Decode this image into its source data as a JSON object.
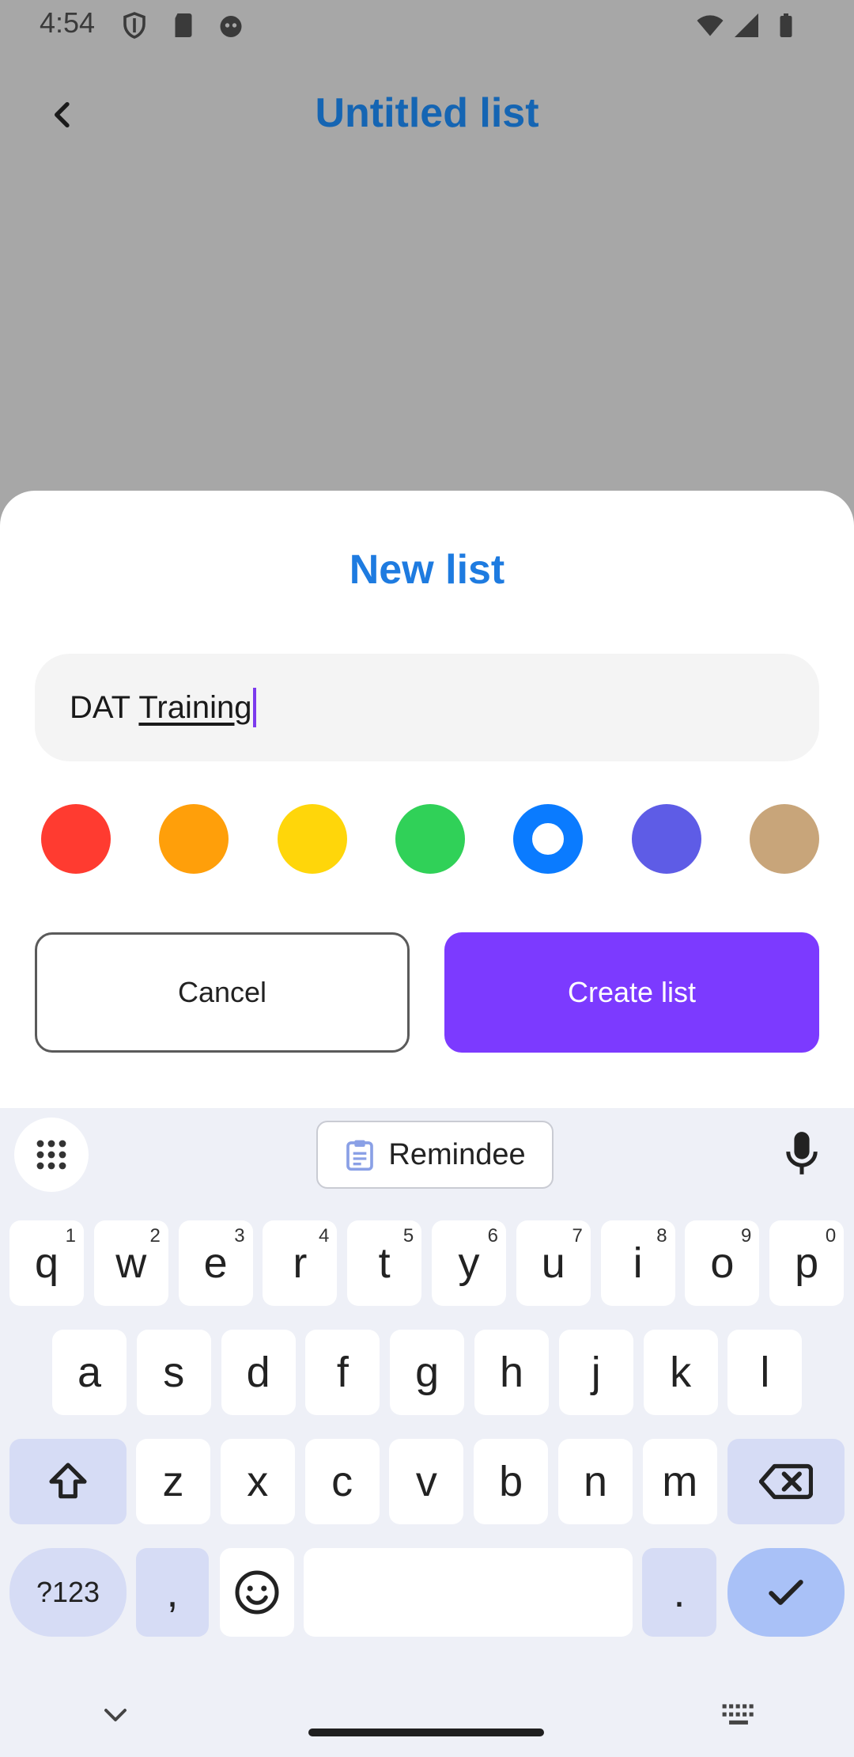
{
  "status_bar": {
    "time": "4:54"
  },
  "app": {
    "title": "Untitled list"
  },
  "sheet": {
    "title": "New list",
    "name_field": {
      "value_plain": "DAT ",
      "value_underlined": "Training"
    },
    "colors": [
      {
        "name": "red",
        "hex": "#ff3b30",
        "selected": false
      },
      {
        "name": "orange",
        "hex": "#ff9f0a",
        "selected": false
      },
      {
        "name": "yellow",
        "hex": "#ffd60a",
        "selected": false
      },
      {
        "name": "green",
        "hex": "#30d158",
        "selected": false
      },
      {
        "name": "blue",
        "hex": "#0a7bff",
        "selected": true
      },
      {
        "name": "indigo",
        "hex": "#5e5ce6",
        "selected": false
      },
      {
        "name": "tan",
        "hex": "#c8a57a",
        "selected": false
      }
    ],
    "cancel_label": "Cancel",
    "create_label": "Create list"
  },
  "keyboard": {
    "suggestion": "Remindee",
    "row1": [
      {
        "k": "q",
        "h": "1"
      },
      {
        "k": "w",
        "h": "2"
      },
      {
        "k": "e",
        "h": "3"
      },
      {
        "k": "r",
        "h": "4"
      },
      {
        "k": "t",
        "h": "5"
      },
      {
        "k": "y",
        "h": "6"
      },
      {
        "k": "u",
        "h": "7"
      },
      {
        "k": "i",
        "h": "8"
      },
      {
        "k": "o",
        "h": "9"
      },
      {
        "k": "p",
        "h": "0"
      }
    ],
    "row2": [
      "a",
      "s",
      "d",
      "f",
      "g",
      "h",
      "j",
      "k",
      "l"
    ],
    "row3": [
      "z",
      "x",
      "c",
      "v",
      "b",
      "n",
      "m"
    ],
    "symbols_label": "?123",
    "comma_label": ",",
    "period_label": "."
  }
}
